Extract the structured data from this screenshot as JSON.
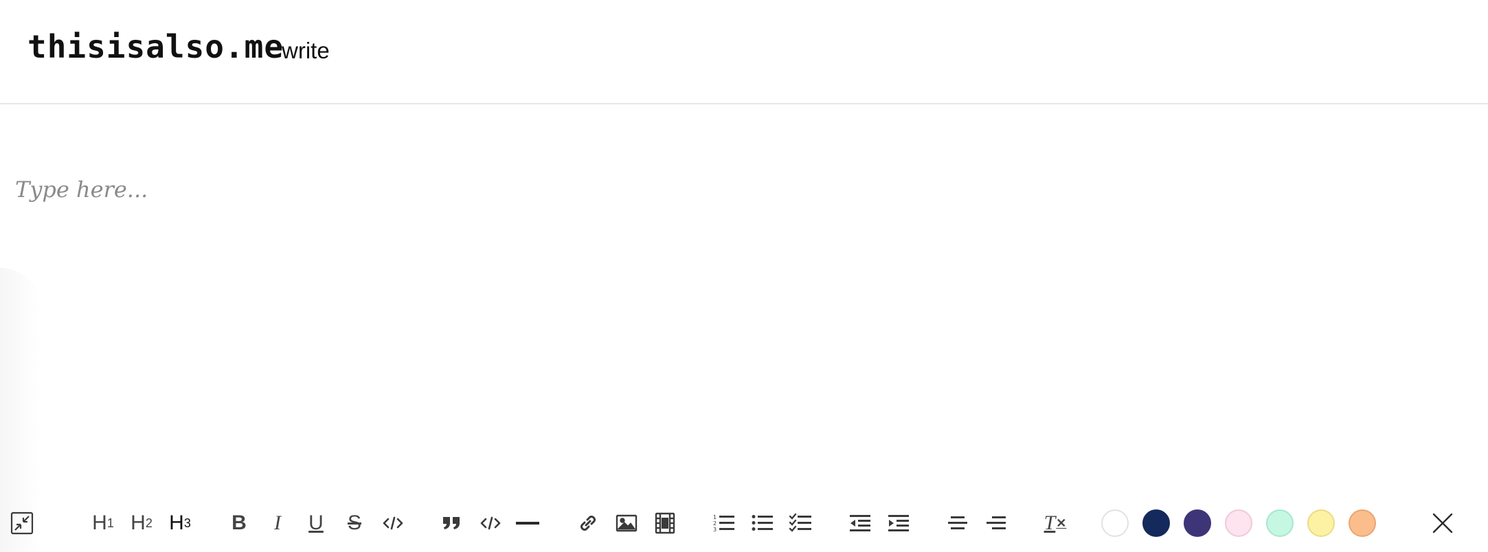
{
  "header": {
    "logo": "thisisalso.me",
    "nav_write": "write"
  },
  "editor": {
    "placeholder": "Type here..."
  },
  "toolbar": {
    "h1_label": "H",
    "h1_sub": "1",
    "h2_label": "H",
    "h2_sub": "2",
    "h3_label": "H",
    "h3_sub": "3",
    "bold_label": "B",
    "italic_label": "I",
    "underline_label": "U",
    "strike_label": "S",
    "clear_format_label": "T",
    "colors": [
      {
        "name": "white",
        "fill": "#ffffff",
        "border": "#e2e2e2"
      },
      {
        "name": "navy",
        "fill": "#142a5c",
        "border": "#142a5c"
      },
      {
        "name": "purple",
        "fill": "#3e3578",
        "border": "#3e3578"
      },
      {
        "name": "pink",
        "fill": "#fde4ef",
        "border": "#efc9d9"
      },
      {
        "name": "mint",
        "fill": "#c6f7e2",
        "border": "#a6e7cc"
      },
      {
        "name": "yellow",
        "fill": "#fdf1a4",
        "border": "#ecdb84"
      },
      {
        "name": "orange",
        "fill": "#fbbd8b",
        "border": "#e9a572"
      }
    ]
  }
}
